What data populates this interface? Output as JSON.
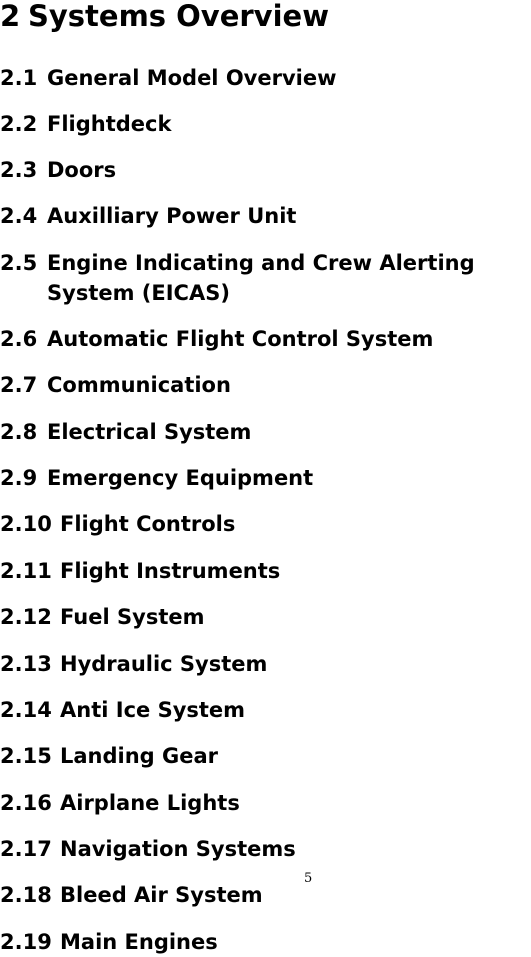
{
  "chapter": {
    "number": "2",
    "title": "Systems Overview"
  },
  "sections": [
    {
      "number": "2.1",
      "title": "General Model Overview"
    },
    {
      "number": "2.2",
      "title": "Flightdeck"
    },
    {
      "number": "2.3",
      "title": "Doors"
    },
    {
      "number": "2.4",
      "title": "Auxilliary Power Unit"
    },
    {
      "number": "2.5",
      "title": "Engine Indicating and Crew Alerting System (EICAS)"
    },
    {
      "number": "2.6",
      "title": "Automatic Flight Control System"
    },
    {
      "number": "2.7",
      "title": "Communication"
    },
    {
      "number": "2.8",
      "title": "Electrical System"
    },
    {
      "number": "2.9",
      "title": "Emergency Equipment"
    },
    {
      "number": "2.10",
      "title": "Flight Controls"
    },
    {
      "number": "2.11",
      "title": "Flight Instruments"
    },
    {
      "number": "2.12",
      "title": "Fuel System"
    },
    {
      "number": "2.13",
      "title": "Hydraulic System"
    },
    {
      "number": "2.14",
      "title": "Anti Ice System"
    },
    {
      "number": "2.15",
      "title": "Landing Gear"
    },
    {
      "number": "2.16",
      "title": "Airplane Lights"
    },
    {
      "number": "2.17",
      "title": "Navigation Systems"
    },
    {
      "number": "2.18",
      "title": "Bleed Air System"
    },
    {
      "number": "2.19",
      "title": "Main Engines"
    }
  ],
  "page_number": "5"
}
